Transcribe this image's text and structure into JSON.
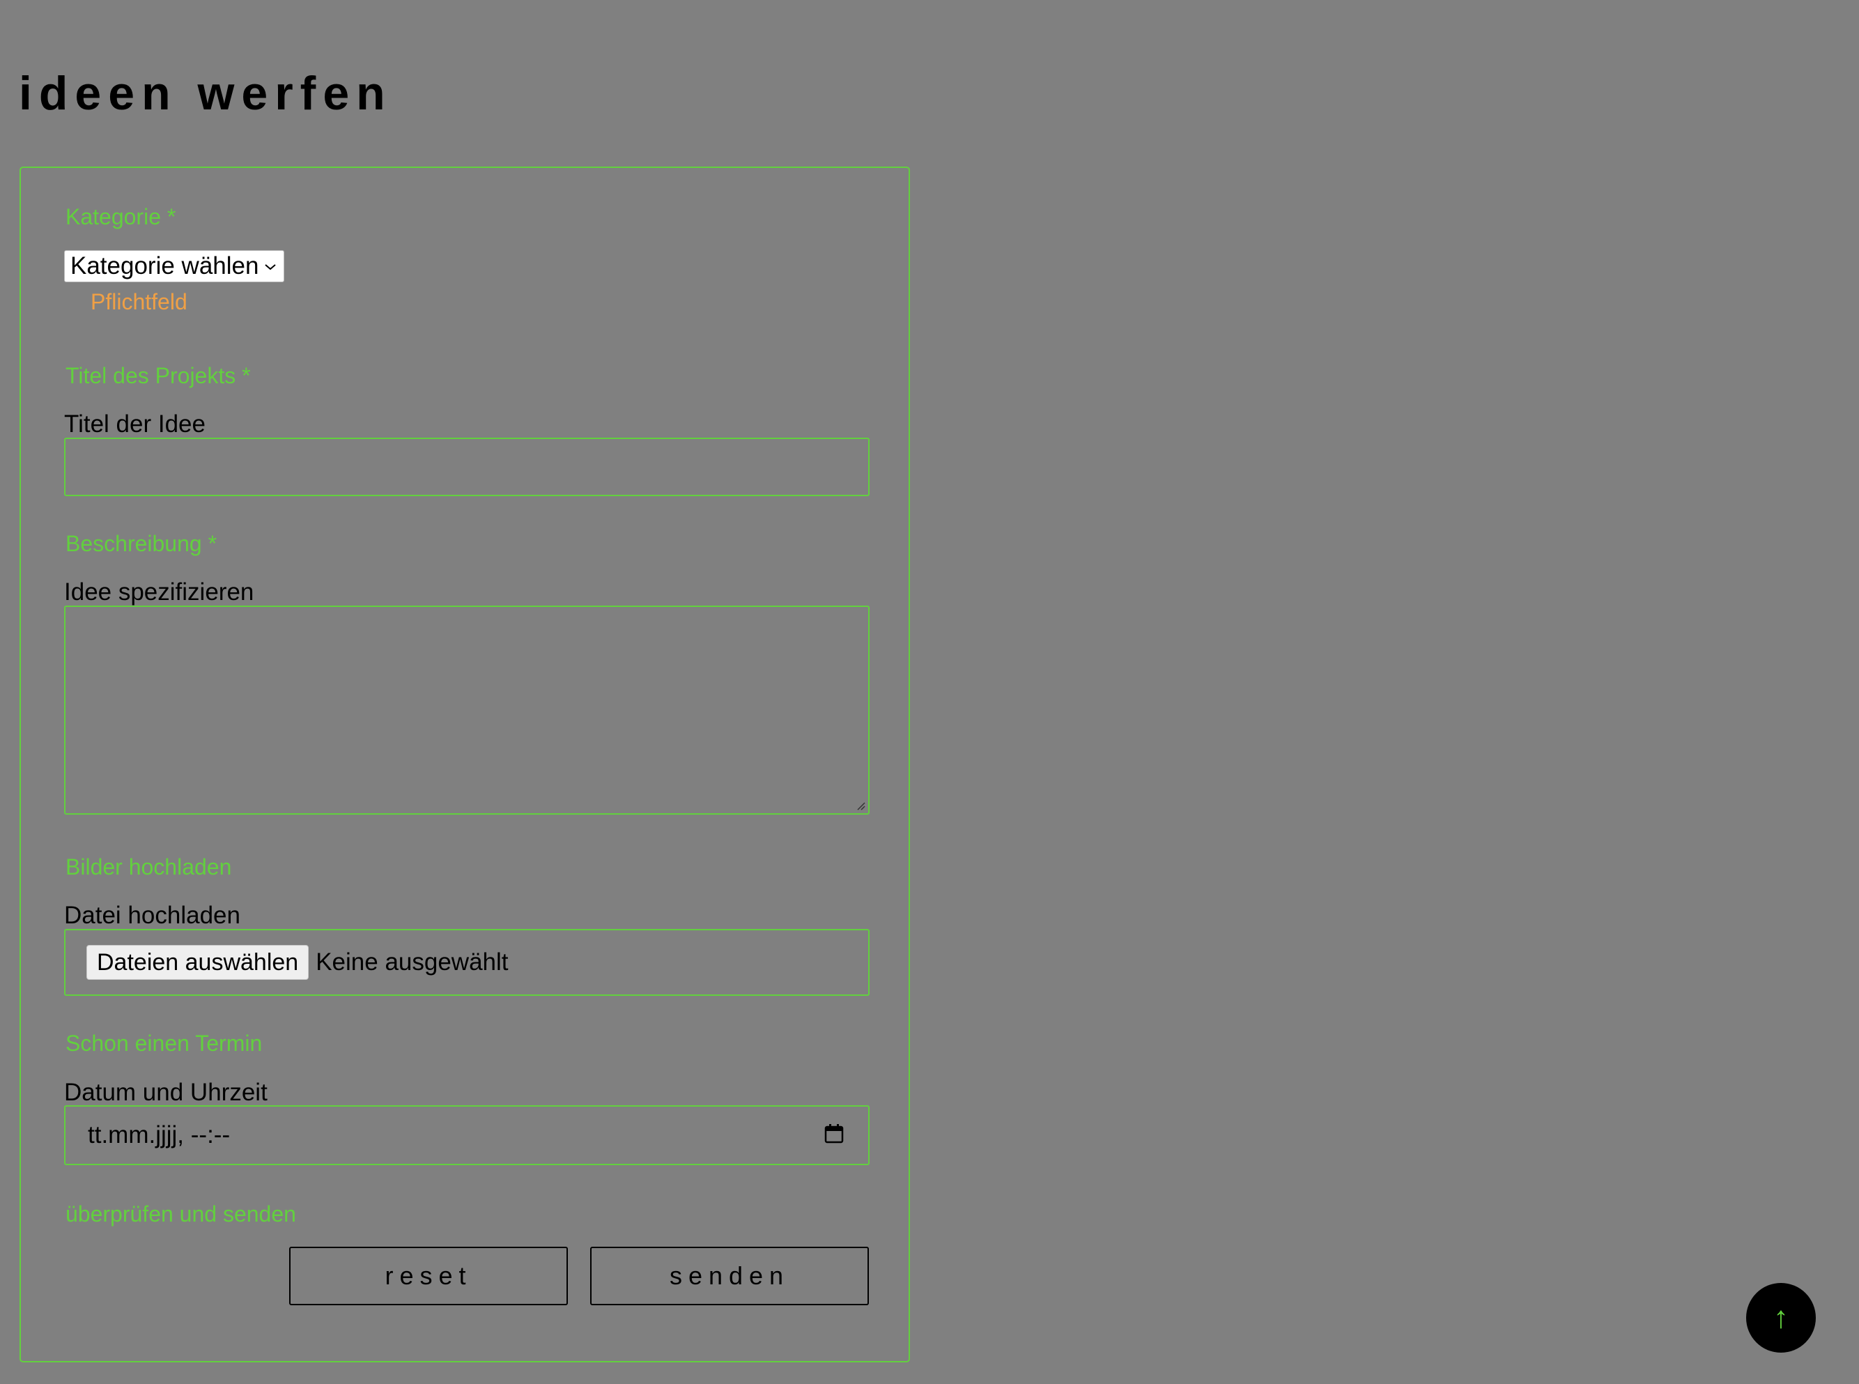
{
  "page": {
    "title": "ideen werfen"
  },
  "colors": {
    "background": "#808080",
    "accent": "#62d03e",
    "hint": "#f0a045",
    "text": "#000000"
  },
  "form": {
    "category": {
      "legend": "Kategorie *",
      "selected": "Kategorie wählen",
      "hint": "Pflichtfeld"
    },
    "title": {
      "legend": "Titel des Projekts *",
      "label": "Titel der Idee",
      "value": ""
    },
    "description": {
      "legend": "Beschreibung *",
      "label": "Idee spezifizieren",
      "value": ""
    },
    "upload": {
      "legend": "Bilder hochladen",
      "label": "Datei hochladen",
      "button": "Dateien auswählen",
      "status": "Keine ausgewählt"
    },
    "appointment": {
      "legend": "Schon einen Termin",
      "label": "Datum und Uhrzeit",
      "placeholder": "tt.mm.jjjj, --:--",
      "icon": "calendar-icon"
    },
    "submit": {
      "legend": "überprüfen und senden",
      "reset": "reset",
      "send": "senden"
    }
  },
  "scroll_top": {
    "icon": "arrow-up-icon",
    "glyph": "↑"
  }
}
